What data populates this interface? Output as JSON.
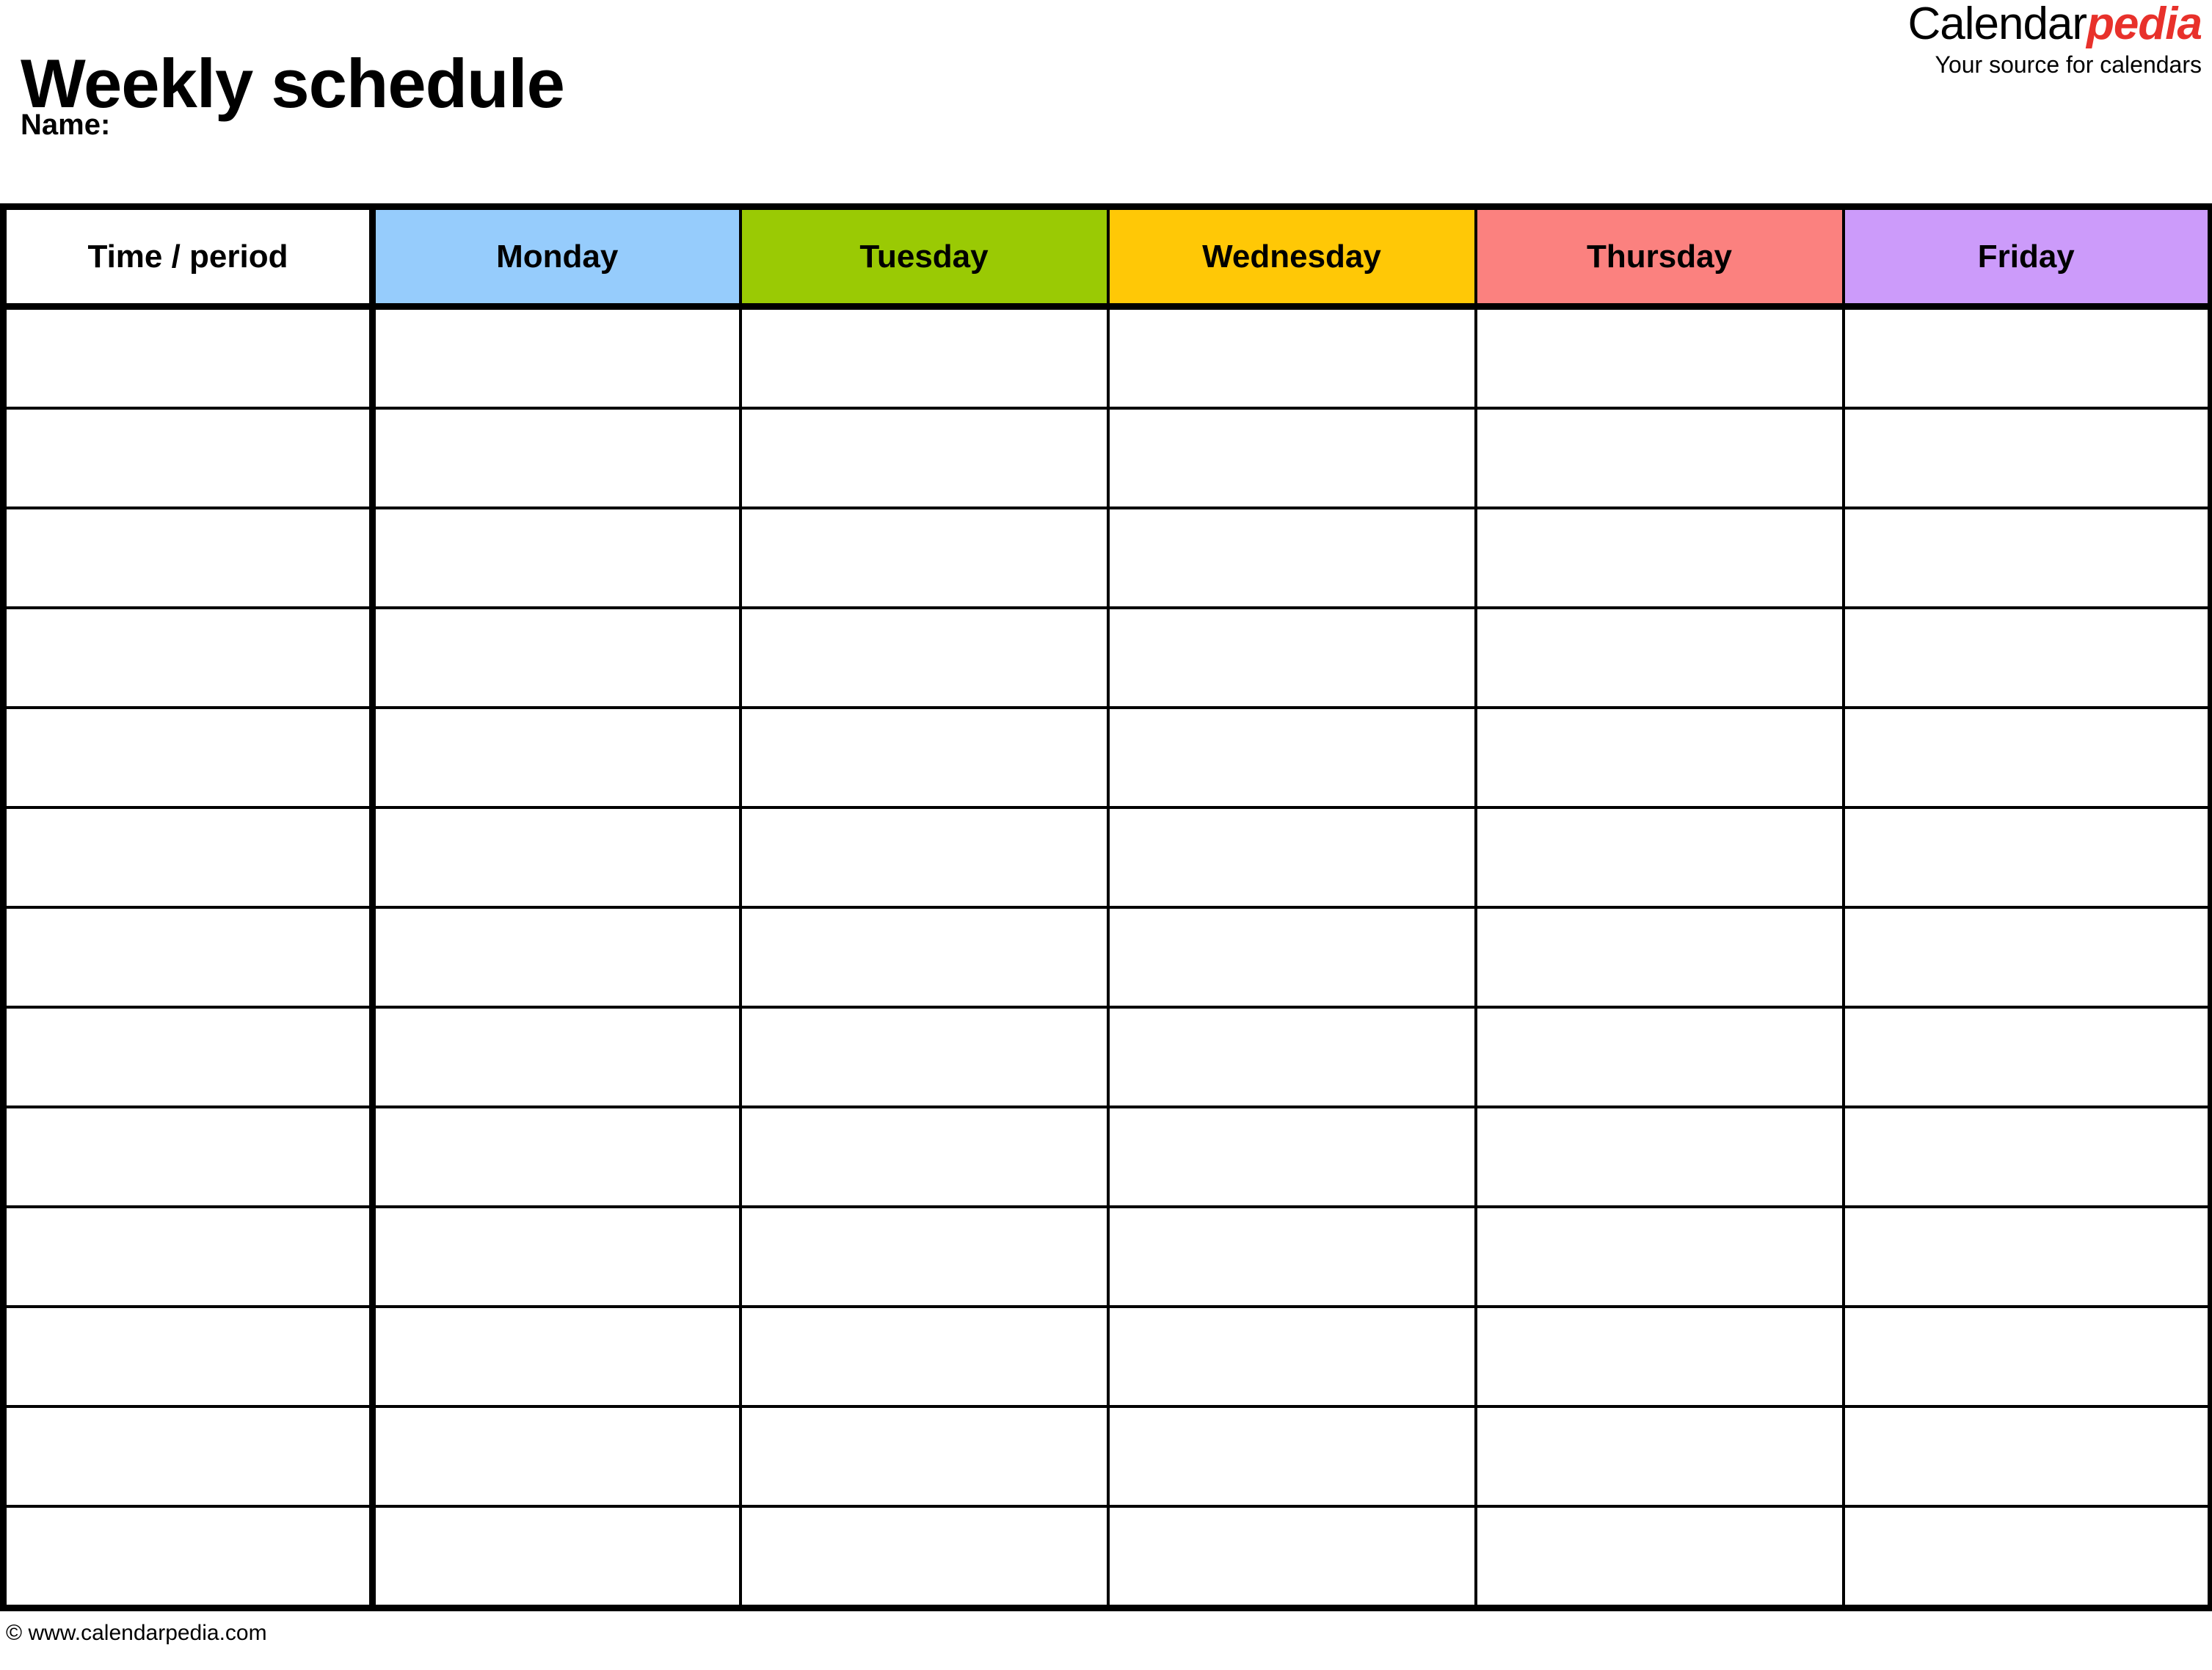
{
  "page": {
    "title": "Weekly schedule",
    "name_label": "Name:"
  },
  "brand": {
    "word_primary": "Calendar",
    "word_accent": "pedia",
    "tagline": "Your source for calendars",
    "accent_color": "#E8312B"
  },
  "table": {
    "columns": [
      {
        "label": "Time / period",
        "color": "#FFFFFF",
        "key": "time"
      },
      {
        "label": "Monday",
        "color": "#96CCFC",
        "key": "monday"
      },
      {
        "label": "Tuesday",
        "color": "#9ACA04",
        "key": "tuesday"
      },
      {
        "label": "Wednesday",
        "color": "#FFC806",
        "key": "wednesday"
      },
      {
        "label": "Thursday",
        "color": "#FB817F",
        "key": "thursday"
      },
      {
        "label": "Friday",
        "color": "#CC9BFA",
        "key": "friday"
      }
    ],
    "row_count": 13,
    "rows": [
      {
        "time": "",
        "monday": "",
        "tuesday": "",
        "wednesday": "",
        "thursday": "",
        "friday": ""
      },
      {
        "time": "",
        "monday": "",
        "tuesday": "",
        "wednesday": "",
        "thursday": "",
        "friday": ""
      },
      {
        "time": "",
        "monday": "",
        "tuesday": "",
        "wednesday": "",
        "thursday": "",
        "friday": ""
      },
      {
        "time": "",
        "monday": "",
        "tuesday": "",
        "wednesday": "",
        "thursday": "",
        "friday": ""
      },
      {
        "time": "",
        "monday": "",
        "tuesday": "",
        "wednesday": "",
        "thursday": "",
        "friday": ""
      },
      {
        "time": "",
        "monday": "",
        "tuesday": "",
        "wednesday": "",
        "thursday": "",
        "friday": ""
      },
      {
        "time": "",
        "monday": "",
        "tuesday": "",
        "wednesday": "",
        "thursday": "",
        "friday": ""
      },
      {
        "time": "",
        "monday": "",
        "tuesday": "",
        "wednesday": "",
        "thursday": "",
        "friday": ""
      },
      {
        "time": "",
        "monday": "",
        "tuesday": "",
        "wednesday": "",
        "thursday": "",
        "friday": ""
      },
      {
        "time": "",
        "monday": "",
        "tuesday": "",
        "wednesday": "",
        "thursday": "",
        "friday": ""
      },
      {
        "time": "",
        "monday": "",
        "tuesday": "",
        "wednesday": "",
        "thursday": "",
        "friday": ""
      },
      {
        "time": "",
        "monday": "",
        "tuesday": "",
        "wednesday": "",
        "thursday": "",
        "friday": ""
      },
      {
        "time": "",
        "monday": "",
        "tuesday": "",
        "wednesday": "",
        "thursday": "",
        "friday": ""
      }
    ]
  },
  "footer": {
    "copyright": "© www.calendarpedia.com"
  }
}
